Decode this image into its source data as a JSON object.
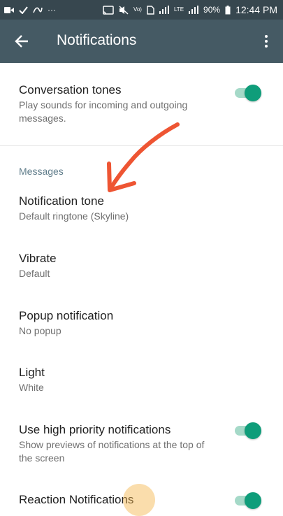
{
  "statusbar": {
    "left_icons": [
      "video-icon",
      "check-icon",
      "signal-wave-icon",
      "more-dots-icon"
    ],
    "battery": "90%",
    "time": "12:44 PM",
    "lte1": "LTE",
    "lte2": "LTE",
    "volte": "Vo)"
  },
  "toolbar": {
    "title": "Notifications"
  },
  "settings": {
    "conversation_tones": {
      "title": "Conversation tones",
      "subtitle": "Play sounds for incoming and outgoing messages.",
      "enabled": true
    },
    "messages_header": "Messages",
    "notification_tone": {
      "title": "Notification tone",
      "subtitle": "Default ringtone (Skyline)"
    },
    "vibrate": {
      "title": "Vibrate",
      "subtitle": "Default"
    },
    "popup": {
      "title": "Popup notification",
      "subtitle": "No popup"
    },
    "light": {
      "title": "Light",
      "subtitle": "White"
    },
    "high_priority": {
      "title": "Use high priority notifications",
      "subtitle": "Show previews of notifications at the top of the screen",
      "enabled": true
    },
    "reaction": {
      "title": "Reaction Notifications",
      "enabled": true
    }
  },
  "colors": {
    "statusbar_bg": "#37474f",
    "toolbar_bg": "#455a64",
    "toggle_on": "#0f9d7a",
    "annotation_arrow": "#ee5533"
  }
}
